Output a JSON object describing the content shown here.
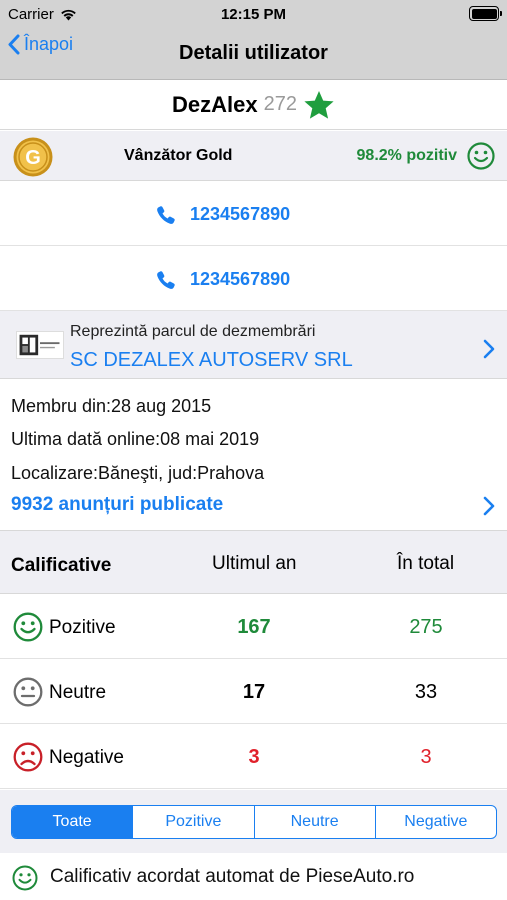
{
  "status_bar": {
    "carrier": "Carrier",
    "time": "12:15 PM"
  },
  "nav": {
    "back_label": "Înapoi",
    "title": "Detalii utilizator"
  },
  "user": {
    "name": "DezAlex",
    "score": "272",
    "badge_icon": "star-icon"
  },
  "seller": {
    "medal_letter": "G",
    "level": "Vânzător Gold",
    "positive": "98.2% pozitiv"
  },
  "phones": [
    "1234567890",
    "1234567890"
  ],
  "dismantler": {
    "caption": "Reprezintă parcul de dezmembrări",
    "company": "SC DEZALEX AUTOSERV SRL"
  },
  "details": {
    "member_since": "Membru din:28 aug 2015",
    "last_online": "Ultima dată online:08 mai 2019",
    "location": "Localizare:Băneşti, jud:Prahova",
    "ads_link": "9932 anunțuri publicate"
  },
  "ratings": {
    "header": {
      "label": "Calificative",
      "last_year": "Ultimul an",
      "total": "În total"
    },
    "rows": [
      {
        "label": "Pozitive",
        "last_year": "167",
        "total": "275",
        "color": "#1f8a3a"
      },
      {
        "label": "Neutre",
        "last_year": "17",
        "total": "33",
        "color": "#000000"
      },
      {
        "label": "Negative",
        "last_year": "3",
        "total": "3",
        "color": "#e0202a"
      }
    ]
  },
  "filter_tabs": {
    "items": [
      "Toate",
      "Pozitive",
      "Neutre",
      "Negative"
    ],
    "selected": "Toate"
  },
  "auto_note": "Calificativ acordat automat de PieseAuto.ro",
  "colors": {
    "accent": "#1a7ff0",
    "positive": "#1f8a3a",
    "negative": "#e0202a",
    "gold": "#d9a520"
  }
}
